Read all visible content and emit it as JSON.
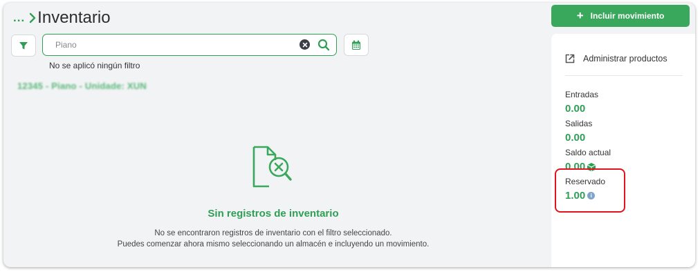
{
  "header": {
    "breadcrumb_dots": "...",
    "title": "Inventario"
  },
  "toolbar": {
    "filter_icon": "filter-icon",
    "search_value": "Piano",
    "clear_icon": "clear-icon",
    "search_icon": "search-icon",
    "calendar_icon": "calendar-icon",
    "no_filter_text": "No se aplicó ningún filtro"
  },
  "product_line": "12345 - Piano - Unidade: XUN",
  "empty_state": {
    "icon": "document-search-x-icon",
    "title": "Sin registros de inventario",
    "line1": "No se encontraron registros de inventario con el filtro seleccionado.",
    "line2": "Puedes comenzar ahora mismo seleccionando un almacén e incluyendo un movimiento."
  },
  "actions": {
    "add_label": "Incluir movimiento",
    "add_icon": "plus-icon"
  },
  "side_panel": {
    "manage_label": "Administrar productos",
    "manage_icon": "external-link-icon",
    "stats": {
      "entradas_label": "Entradas",
      "entradas_value": "0.00",
      "salidas_label": "Salidas",
      "salidas_value": "0.00",
      "saldo_label": "Saldo actual",
      "saldo_value": "0.00",
      "reservado_label": "Reservado",
      "reservado_value": "1.00"
    }
  },
  "colors": {
    "accent": "#2f9e55",
    "button": "#3aa85c",
    "highlight": "#e0121b"
  }
}
